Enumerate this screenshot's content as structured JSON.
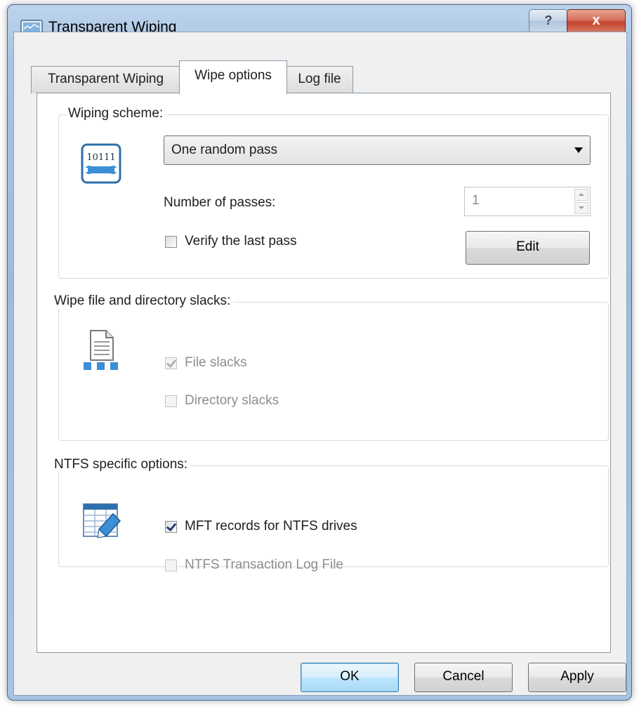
{
  "window": {
    "title": "Transparent Wiping",
    "help_label": "?",
    "close_label": "x"
  },
  "tabs": [
    {
      "label": "Transparent Wiping",
      "active": false
    },
    {
      "label": "Wipe options",
      "active": true
    },
    {
      "label": "Log file",
      "active": false
    }
  ],
  "wiping_scheme": {
    "group_label": "Wiping scheme:",
    "icon_text": "10111",
    "scheme_value": "One random pass",
    "passes_label": "Number of passes:",
    "passes_value": "1",
    "verify_label": "Verify the last pass",
    "verify_checked": false,
    "edit_label": "Edit"
  },
  "slacks": {
    "group_label": "Wipe file and directory slacks:",
    "file_slacks_label": "File slacks",
    "file_slacks_checked": true,
    "directory_slacks_label": "Directory slacks",
    "directory_slacks_checked": false
  },
  "ntfs": {
    "group_label": "NTFS specific options:",
    "mft_label": "MFT records for NTFS drives",
    "mft_checked": true,
    "txlog_label": "NTFS Transaction Log File",
    "txlog_checked": false
  },
  "buttons": {
    "ok": "OK",
    "cancel": "Cancel",
    "apply": "Apply"
  },
  "colors": {
    "title_bar": "#a9c4e2",
    "close_button": "#c4432c",
    "default_button": "#bee6fd",
    "icon_blue": "#3a8fd6"
  }
}
